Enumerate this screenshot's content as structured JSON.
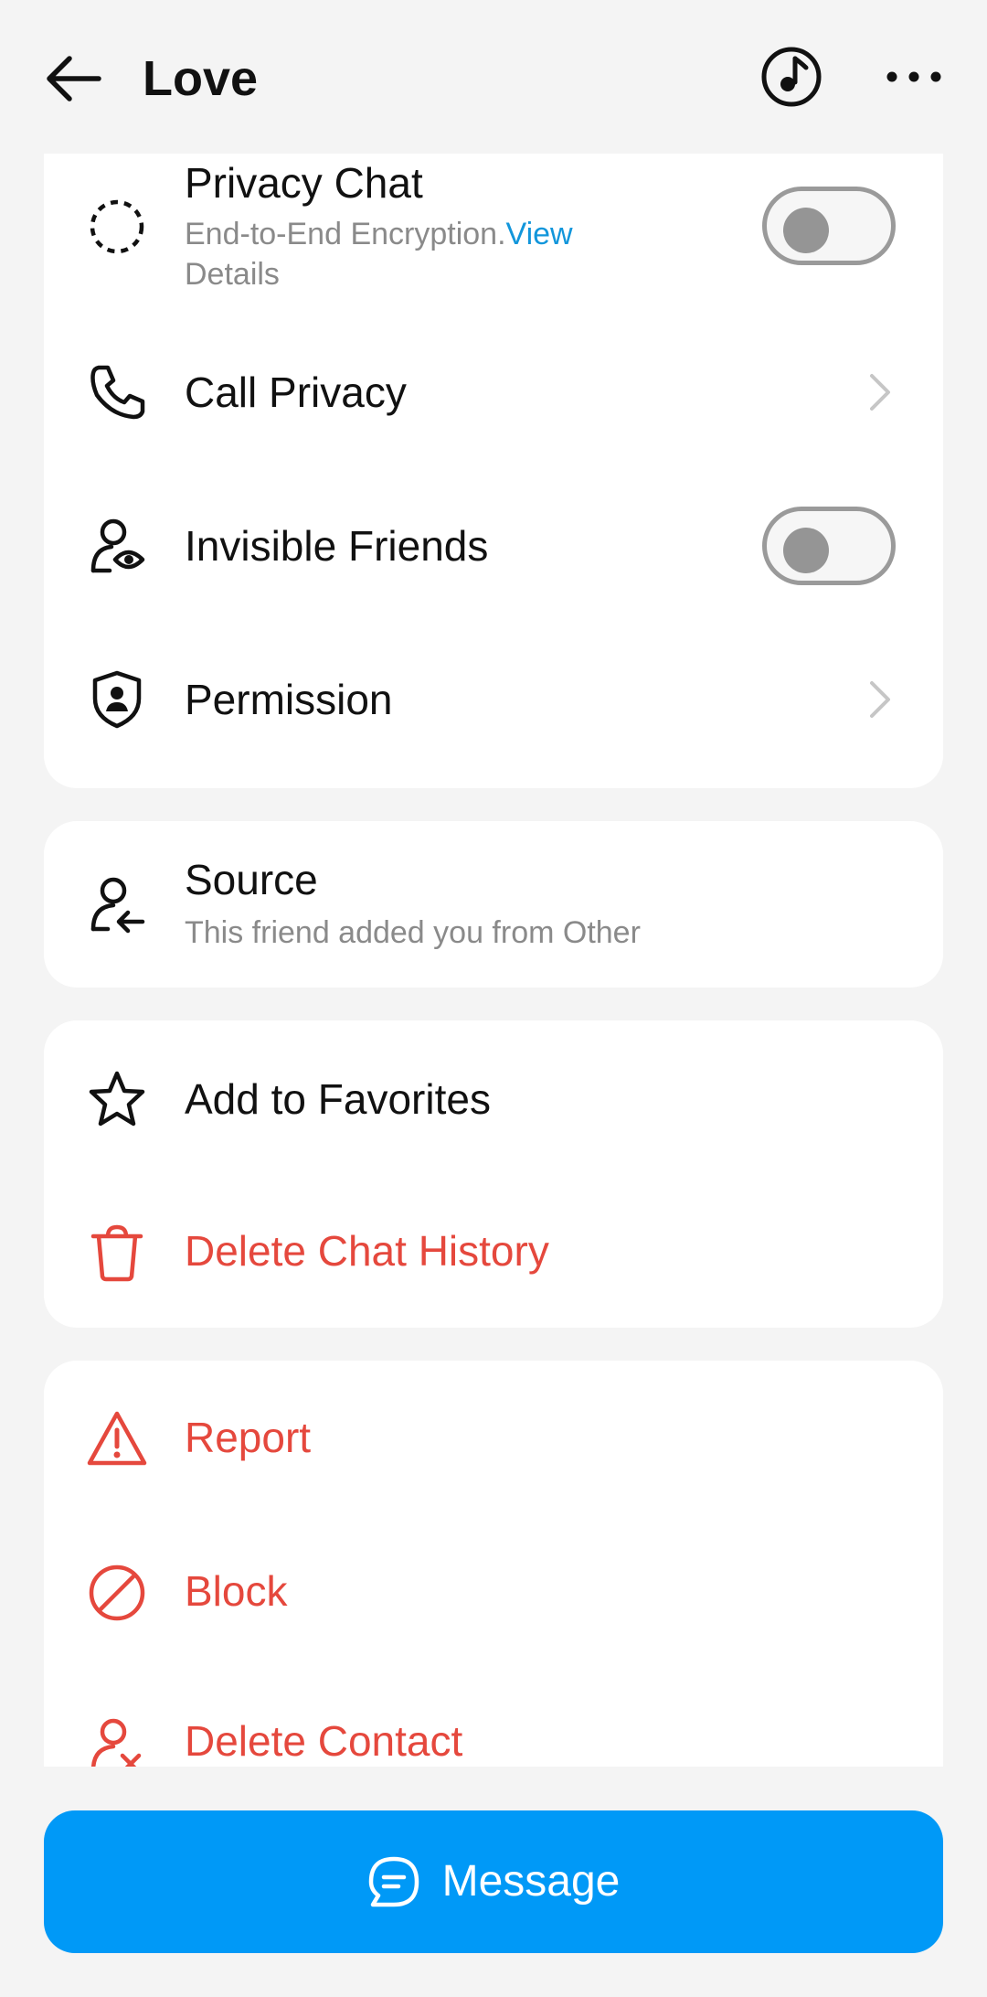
{
  "header": {
    "title": "Love",
    "back_icon": "arrow-left-icon",
    "music_icon": "music-note-icon",
    "more_icon": "more-horizontal-icon"
  },
  "privacy_card": {
    "items": [
      {
        "label": "Privacy Chat",
        "subtitle_prefix": "End-to-End Encryption.",
        "subtitle_link_line1": "View",
        "subtitle_link_line2": "Details",
        "icon": "dashed-circle-icon",
        "control": "toggle",
        "on": false
      },
      {
        "label": "Call Privacy",
        "icon": "phone-icon",
        "control": "chevron"
      },
      {
        "label": "Invisible Friends",
        "icon": "user-eye-icon",
        "control": "toggle",
        "on": false
      },
      {
        "label": "Permission",
        "icon": "shield-user-icon",
        "control": "chevron"
      }
    ]
  },
  "source_card": {
    "label": "Source",
    "subtitle": "This friend added you from Other",
    "icon": "user-arrow-icon"
  },
  "favorites_card": {
    "items": [
      {
        "label": "Add to Favorites",
        "icon": "star-icon"
      },
      {
        "label": "Delete Chat History",
        "icon": "trash-icon"
      }
    ]
  },
  "danger_card": {
    "items": [
      {
        "label": "Report",
        "icon": "warning-icon"
      },
      {
        "label": "Block",
        "icon": "block-icon"
      },
      {
        "label": "Delete Contact",
        "icon": "user-remove-icon"
      }
    ]
  },
  "message_button": {
    "label": "Message",
    "icon": "chat-bubble-icon"
  },
  "colors": {
    "accent": "#0099f7",
    "link": "#1296db",
    "danger": "#e5483d",
    "background": "#f4f4f4"
  }
}
